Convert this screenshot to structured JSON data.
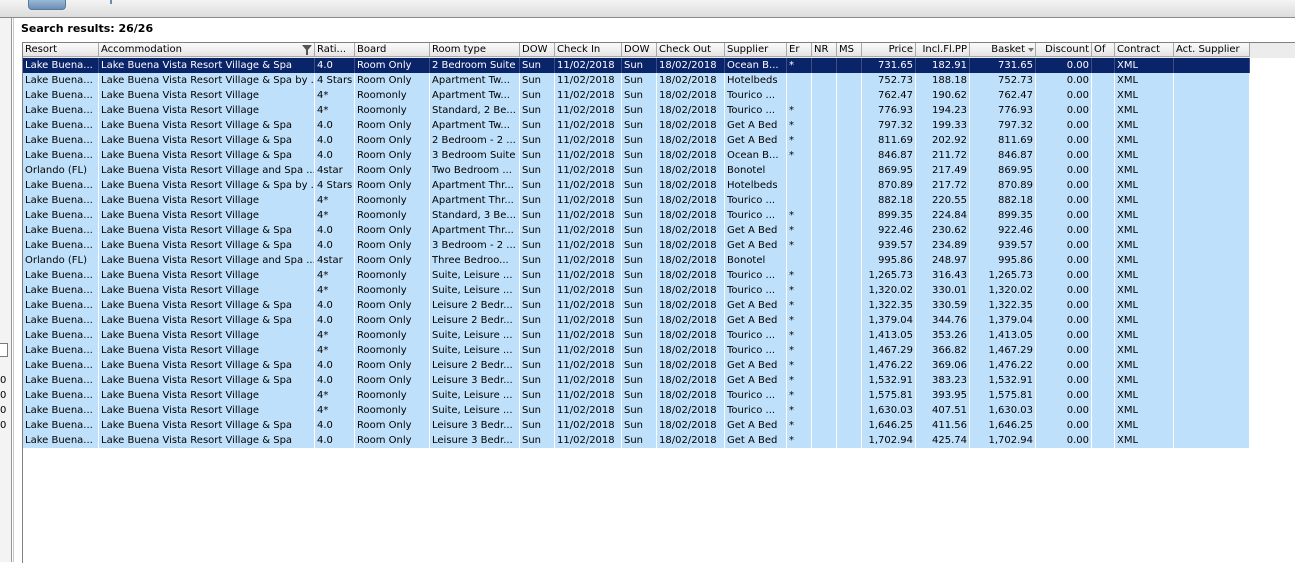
{
  "app": {
    "results_text": "Search results: 26/26"
  },
  "left_panel": {
    "digits": [
      "0",
      "0",
      "0",
      "0"
    ]
  },
  "columns": [
    {
      "key": "resort",
      "label": "Resort",
      "w": 76
    },
    {
      "key": "acc",
      "label": "Accommodation",
      "w": 216,
      "filter": true
    },
    {
      "key": "rating",
      "label": "Rati...",
      "w": 40
    },
    {
      "key": "board",
      "label": "Board",
      "w": 75
    },
    {
      "key": "room",
      "label": "Room type",
      "w": 90
    },
    {
      "key": "dow1",
      "label": "DOW",
      "w": 35
    },
    {
      "key": "checkin",
      "label": "Check In",
      "w": 67
    },
    {
      "key": "dow2",
      "label": "DOW",
      "w": 35
    },
    {
      "key": "checkout",
      "label": "Check Out",
      "w": 68
    },
    {
      "key": "supplier",
      "label": "Supplier",
      "w": 62
    },
    {
      "key": "er",
      "label": "Er",
      "w": 25
    },
    {
      "key": "nr",
      "label": "NR",
      "w": 25
    },
    {
      "key": "ms",
      "label": "MS",
      "w": 25,
      "align": "c"
    },
    {
      "key": "price",
      "label": "Price",
      "w": 54,
      "align": "r"
    },
    {
      "key": "incl",
      "label": "Incl.Fl.PP",
      "w": 54,
      "align": "r"
    },
    {
      "key": "basket",
      "label": "Basket",
      "w": 66,
      "align": "r",
      "sort": true
    },
    {
      "key": "discount",
      "label": "Discount",
      "w": 56,
      "align": "r"
    },
    {
      "key": "of",
      "label": "Of",
      "w": 23
    },
    {
      "key": "contract",
      "label": "Contract",
      "w": 59
    },
    {
      "key": "act",
      "label": "Act. Supplier",
      "w": 76
    }
  ],
  "rows": [
    [
      "Lake Buena...",
      "Lake Buena Vista Resort Village & Spa",
      "4.0",
      "Room Only",
      "2 Bedroom Suite",
      "Sun",
      "11/02/2018",
      "Sun",
      "18/02/2018",
      "Ocean B...",
      "*",
      "",
      "",
      "731.65",
      "182.91",
      "731.65",
      "0.00",
      "",
      "XML",
      ""
    ],
    [
      "Lake Buena...",
      "Lake Buena Vista Resort Village & Spa by ...",
      "4 Stars",
      "Room Only",
      "Apartment Tw...",
      "Sun",
      "11/02/2018",
      "Sun",
      "18/02/2018",
      "Hotelbeds",
      "",
      "",
      "",
      "752.73",
      "188.18",
      "752.73",
      "0.00",
      "",
      "XML",
      ""
    ],
    [
      "Lake Buena...",
      "Lake Buena Vista Resort Village",
      "4*",
      "Roomonly",
      "Apartment Tw...",
      "Sun",
      "11/02/2018",
      "Sun",
      "18/02/2018",
      "Tourico ...",
      "",
      "",
      "",
      "762.47",
      "190.62",
      "762.47",
      "0.00",
      "",
      "XML",
      ""
    ],
    [
      "Lake Buena...",
      "Lake Buena Vista Resort Village",
      "4*",
      "Roomonly",
      "Standard, 2 Be...",
      "Sun",
      "11/02/2018",
      "Sun",
      "18/02/2018",
      "Tourico ...",
      "*",
      "",
      "",
      "776.93",
      "194.23",
      "776.93",
      "0.00",
      "",
      "XML",
      ""
    ],
    [
      "Lake Buena...",
      "Lake Buena Vista Resort Village & Spa",
      "4.0",
      "Room Only",
      "Apartment Tw...",
      "Sun",
      "11/02/2018",
      "Sun",
      "18/02/2018",
      "Get A Bed",
      "*",
      "",
      "",
      "797.32",
      "199.33",
      "797.32",
      "0.00",
      "",
      "XML",
      ""
    ],
    [
      "Lake Buena...",
      "Lake Buena Vista Resort Village & Spa",
      "4.0",
      "Room Only",
      "2 Bedroom - 2 ...",
      "Sun",
      "11/02/2018",
      "Sun",
      "18/02/2018",
      "Get A Bed",
      "*",
      "",
      "",
      "811.69",
      "202.92",
      "811.69",
      "0.00",
      "",
      "XML",
      ""
    ],
    [
      "Lake Buena...",
      "Lake Buena Vista Resort Village & Spa",
      "4.0",
      "Room Only",
      "3 Bedroom Suite",
      "Sun",
      "11/02/2018",
      "Sun",
      "18/02/2018",
      "Ocean B...",
      "*",
      "",
      "",
      "846.87",
      "211.72",
      "846.87",
      "0.00",
      "",
      "XML",
      ""
    ],
    [
      "Orlando (FL)",
      "Lake Buena Vista Resort Village and Spa ...",
      "4star",
      "Room Only",
      "Two Bedroom ...",
      "Sun",
      "11/02/2018",
      "Sun",
      "18/02/2018",
      "Bonotel",
      "",
      "",
      "",
      "869.95",
      "217.49",
      "869.95",
      "0.00",
      "",
      "XML",
      ""
    ],
    [
      "Lake Buena...",
      "Lake Buena Vista Resort Village & Spa by ...",
      "4 Stars",
      "Room Only",
      "Apartment Thr...",
      "Sun",
      "11/02/2018",
      "Sun",
      "18/02/2018",
      "Hotelbeds",
      "",
      "",
      "",
      "870.89",
      "217.72",
      "870.89",
      "0.00",
      "",
      "XML",
      ""
    ],
    [
      "Lake Buena...",
      "Lake Buena Vista Resort Village",
      "4*",
      "Roomonly",
      "Apartment Thr...",
      "Sun",
      "11/02/2018",
      "Sun",
      "18/02/2018",
      "Tourico ...",
      "",
      "",
      "",
      "882.18",
      "220.55",
      "882.18",
      "0.00",
      "",
      "XML",
      ""
    ],
    [
      "Lake Buena...",
      "Lake Buena Vista Resort Village",
      "4*",
      "Roomonly",
      "Standard, 3 Be...",
      "Sun",
      "11/02/2018",
      "Sun",
      "18/02/2018",
      "Tourico ...",
      "*",
      "",
      "",
      "899.35",
      "224.84",
      "899.35",
      "0.00",
      "",
      "XML",
      ""
    ],
    [
      "Lake Buena...",
      "Lake Buena Vista Resort Village & Spa",
      "4.0",
      "Room Only",
      "Apartment Thr...",
      "Sun",
      "11/02/2018",
      "Sun",
      "18/02/2018",
      "Get A Bed",
      "*",
      "",
      "",
      "922.46",
      "230.62",
      "922.46",
      "0.00",
      "",
      "XML",
      ""
    ],
    [
      "Lake Buena...",
      "Lake Buena Vista Resort Village & Spa",
      "4.0",
      "Room Only",
      "3 Bedroom - 2 ...",
      "Sun",
      "11/02/2018",
      "Sun",
      "18/02/2018",
      "Get A Bed",
      "*",
      "",
      "",
      "939.57",
      "234.89",
      "939.57",
      "0.00",
      "",
      "XML",
      ""
    ],
    [
      "Orlando (FL)",
      "Lake Buena Vista Resort Village and Spa ...",
      "4star",
      "Room Only",
      "Three Bedroo...",
      "Sun",
      "11/02/2018",
      "Sun",
      "18/02/2018",
      "Bonotel",
      "",
      "",
      "",
      "995.86",
      "248.97",
      "995.86",
      "0.00",
      "",
      "XML",
      ""
    ],
    [
      "Lake Buena...",
      "Lake Buena Vista Resort Village",
      "4*",
      "Roomonly",
      "Suite, Leisure ...",
      "Sun",
      "11/02/2018",
      "Sun",
      "18/02/2018",
      "Tourico ...",
      "*",
      "",
      "",
      "1,265.73",
      "316.43",
      "1,265.73",
      "0.00",
      "",
      "XML",
      ""
    ],
    [
      "Lake Buena...",
      "Lake Buena Vista Resort Village",
      "4*",
      "Roomonly",
      "Suite, Leisure ...",
      "Sun",
      "11/02/2018",
      "Sun",
      "18/02/2018",
      "Tourico ...",
      "*",
      "",
      "",
      "1,320.02",
      "330.01",
      "1,320.02",
      "0.00",
      "",
      "XML",
      ""
    ],
    [
      "Lake Buena...",
      "Lake Buena Vista Resort Village & Spa",
      "4.0",
      "Room Only",
      "Leisure 2 Bedr...",
      "Sun",
      "11/02/2018",
      "Sun",
      "18/02/2018",
      "Get A Bed",
      "*",
      "",
      "",
      "1,322.35",
      "330.59",
      "1,322.35",
      "0.00",
      "",
      "XML",
      ""
    ],
    [
      "Lake Buena...",
      "Lake Buena Vista Resort Village & Spa",
      "4.0",
      "Room Only",
      "Leisure 2 Bedr...",
      "Sun",
      "11/02/2018",
      "Sun",
      "18/02/2018",
      "Get A Bed",
      "*",
      "",
      "",
      "1,379.04",
      "344.76",
      "1,379.04",
      "0.00",
      "",
      "XML",
      ""
    ],
    [
      "Lake Buena...",
      "Lake Buena Vista Resort Village",
      "4*",
      "Roomonly",
      "Suite, Leisure ...",
      "Sun",
      "11/02/2018",
      "Sun",
      "18/02/2018",
      "Tourico ...",
      "*",
      "",
      "",
      "1,413.05",
      "353.26",
      "1,413.05",
      "0.00",
      "",
      "XML",
      ""
    ],
    [
      "Lake Buena...",
      "Lake Buena Vista Resort Village",
      "4*",
      "Roomonly",
      "Suite, Leisure ...",
      "Sun",
      "11/02/2018",
      "Sun",
      "18/02/2018",
      "Tourico ...",
      "*",
      "",
      "",
      "1,467.29",
      "366.82",
      "1,467.29",
      "0.00",
      "",
      "XML",
      ""
    ],
    [
      "Lake Buena...",
      "Lake Buena Vista Resort Village & Spa",
      "4.0",
      "Room Only",
      "Leisure 2 Bedr...",
      "Sun",
      "11/02/2018",
      "Sun",
      "18/02/2018",
      "Get A Bed",
      "*",
      "",
      "",
      "1,476.22",
      "369.06",
      "1,476.22",
      "0.00",
      "",
      "XML",
      ""
    ],
    [
      "Lake Buena...",
      "Lake Buena Vista Resort Village & Spa",
      "4.0",
      "Room Only",
      "Leisure 3 Bedr...",
      "Sun",
      "11/02/2018",
      "Sun",
      "18/02/2018",
      "Get A Bed",
      "*",
      "",
      "",
      "1,532.91",
      "383.23",
      "1,532.91",
      "0.00",
      "",
      "XML",
      ""
    ],
    [
      "Lake Buena...",
      "Lake Buena Vista Resort Village",
      "4*",
      "Roomonly",
      "Suite, Leisure ...",
      "Sun",
      "11/02/2018",
      "Sun",
      "18/02/2018",
      "Tourico ...",
      "*",
      "",
      "",
      "1,575.81",
      "393.95",
      "1,575.81",
      "0.00",
      "",
      "XML",
      ""
    ],
    [
      "Lake Buena...",
      "Lake Buena Vista Resort Village",
      "4*",
      "Roomonly",
      "Suite, Leisure ...",
      "Sun",
      "11/02/2018",
      "Sun",
      "18/02/2018",
      "Tourico ...",
      "*",
      "",
      "",
      "1,630.03",
      "407.51",
      "1,630.03",
      "0.00",
      "",
      "XML",
      ""
    ],
    [
      "Lake Buena...",
      "Lake Buena Vista Resort Village & Spa",
      "4.0",
      "Room Only",
      "Leisure 3 Bedr...",
      "Sun",
      "11/02/2018",
      "Sun",
      "18/02/2018",
      "Get A Bed",
      "*",
      "",
      "",
      "1,646.25",
      "411.56",
      "1,646.25",
      "0.00",
      "",
      "XML",
      ""
    ],
    [
      "Lake Buena...",
      "Lake Buena Vista Resort Village & Spa",
      "4.0",
      "Room Only",
      "Leisure 3 Bedr...",
      "Sun",
      "11/02/2018",
      "Sun",
      "18/02/2018",
      "Get A Bed",
      "*",
      "",
      "",
      "1,702.94",
      "425.74",
      "1,702.94",
      "0.00",
      "",
      "XML",
      ""
    ]
  ],
  "selected_row": 0,
  "colors": {
    "row_bg": "#bfe0fa",
    "selected_bg": "#0a246a",
    "selected_fg": "#ffffff"
  }
}
